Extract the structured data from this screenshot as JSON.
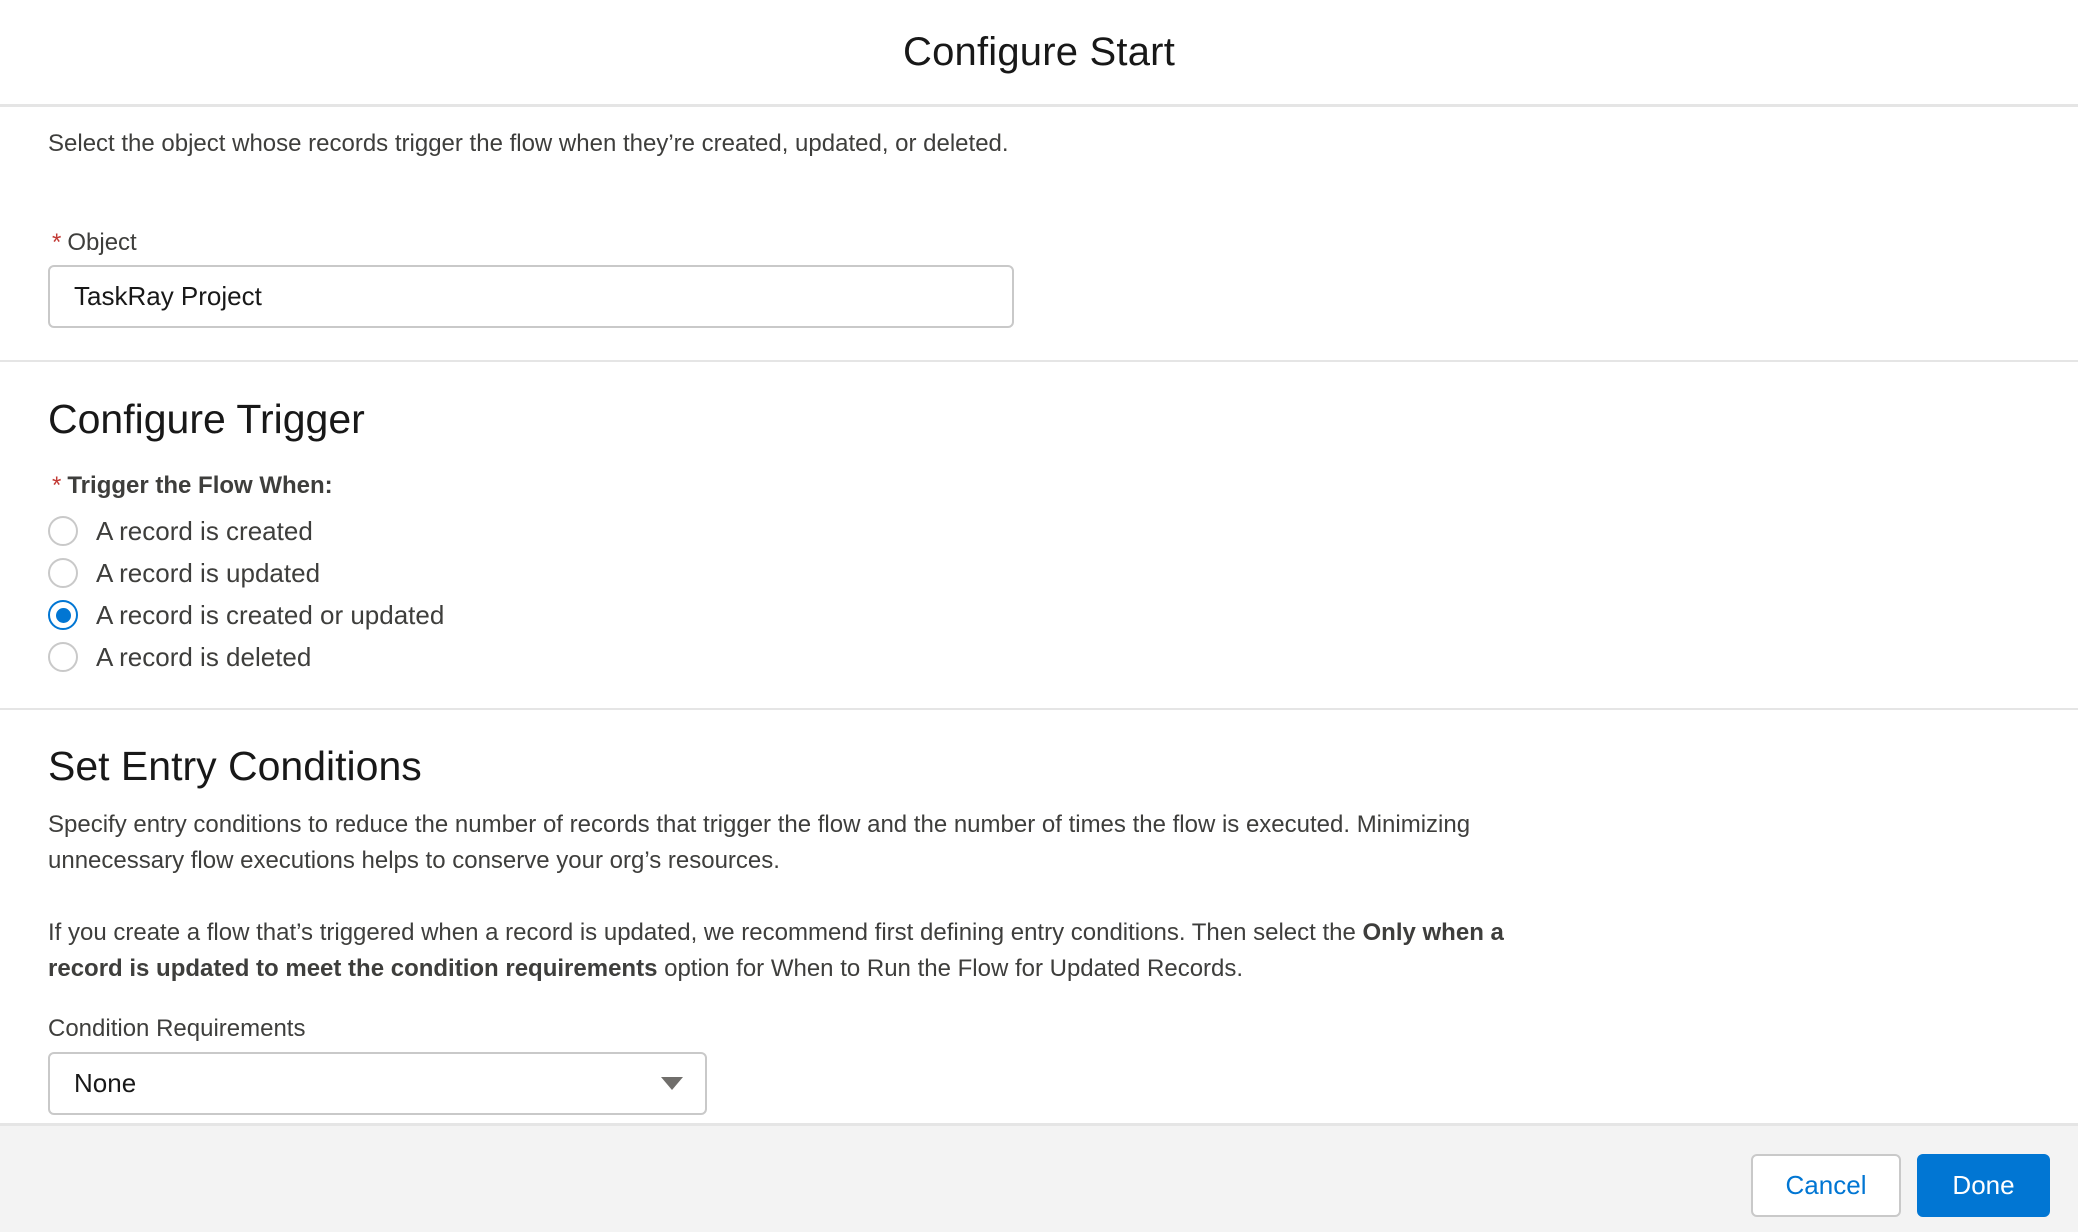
{
  "header": {
    "title": "Configure Start"
  },
  "object_section": {
    "help_text": "Select the object whose records trigger the flow when they’re created, updated, or deleted.",
    "required_mark": "*",
    "label": "Object",
    "value": "TaskRay Project"
  },
  "trigger_section": {
    "title": "Configure Trigger",
    "required_mark": "*",
    "label": "Trigger the Flow When:",
    "options": [
      {
        "label": "A record is created",
        "checked": false
      },
      {
        "label": "A record is updated",
        "checked": false
      },
      {
        "label": "A record is created or updated",
        "checked": true
      },
      {
        "label": "A record is deleted",
        "checked": false
      }
    ]
  },
  "entry_section": {
    "title": "Set Entry Conditions",
    "para1": "Specify entry conditions to reduce the number of records that trigger the flow and the number of times the flow is executed. Minimizing unnecessary flow executions helps to conserve your org’s resources.",
    "para2_prefix": "If you create a flow that’s triggered when a record is updated, we recommend first defining entry conditions. Then select the ",
    "para2_bold": "Only when a record is updated to meet the condition requirements",
    "para2_suffix": " option for When to Run the Flow for Updated Records.",
    "condition_label": "Condition Requirements",
    "condition_value": "None"
  },
  "footer": {
    "cancel_label": "Cancel",
    "done_label": "Done"
  },
  "colors": {
    "brand": "#0176d3",
    "required": "#c23934",
    "border": "#c9c9c9",
    "footer_bg": "#f3f3f3"
  },
  "icons": {
    "select_caret": "chevron-down-icon"
  }
}
